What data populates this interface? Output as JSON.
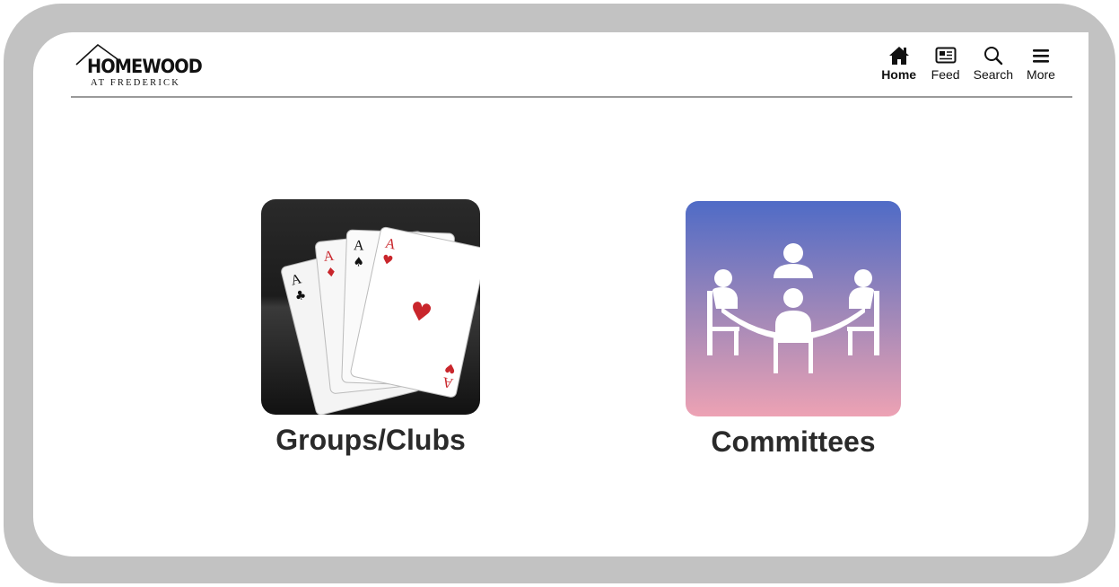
{
  "logo": {
    "main": "HOMEWOOD",
    "sub": "AT FREDERICK"
  },
  "nav": {
    "items": [
      {
        "label": "Home",
        "icon": "home-icon",
        "active": true
      },
      {
        "label": "Feed",
        "icon": "newspaper-icon",
        "active": false
      },
      {
        "label": "Search",
        "icon": "search-icon",
        "active": false
      },
      {
        "label": "More",
        "icon": "menu-icon",
        "active": false
      }
    ]
  },
  "tiles": [
    {
      "label": "Groups/Clubs",
      "icon": "playing-cards-icon"
    },
    {
      "label": "Committees",
      "icon": "meeting-table-icon"
    }
  ],
  "colors": {
    "frame": "#c2c2c2",
    "committees_gradient_top": "#4f6bc6",
    "committees_gradient_bottom": "#eda2b4",
    "groups_bg": "#1e1e1e",
    "card_red": "#c9262c"
  }
}
